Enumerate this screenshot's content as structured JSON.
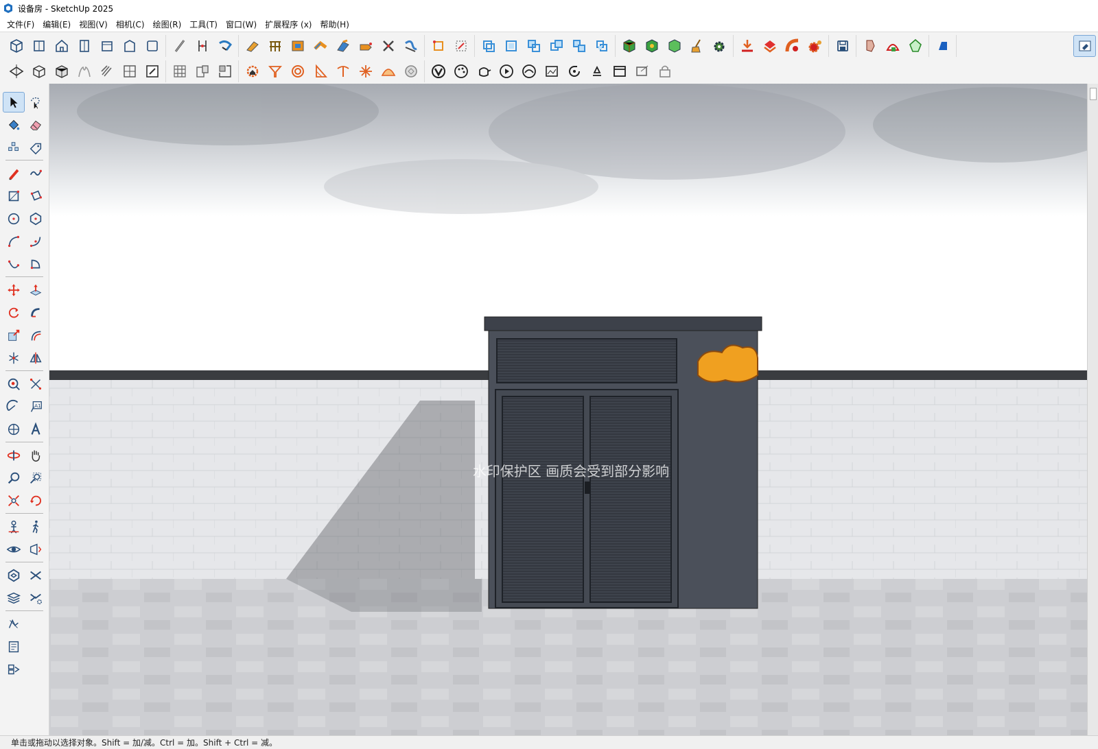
{
  "window": {
    "title": "设备房 - SketchUp 2025"
  },
  "menu": {
    "items": [
      "文件(F)",
      "编辑(E)",
      "视图(V)",
      "相机(C)",
      "绘图(R)",
      "工具(T)",
      "窗口(W)",
      "扩展程序 (x)",
      "帮助(H)"
    ]
  },
  "viewport": {
    "watermark": "水印保护区  画质会受到部分影响",
    "wall_color": "#e9eaec",
    "floor_color": "#c9cacd",
    "cabinet_color": "#4b505a",
    "ornament_color": "#f0a020"
  },
  "status": {
    "hint": "单击或拖动以选择对象。Shift = 加/减。Ctrl = 加。Shift + Ctrl = 减。"
  }
}
